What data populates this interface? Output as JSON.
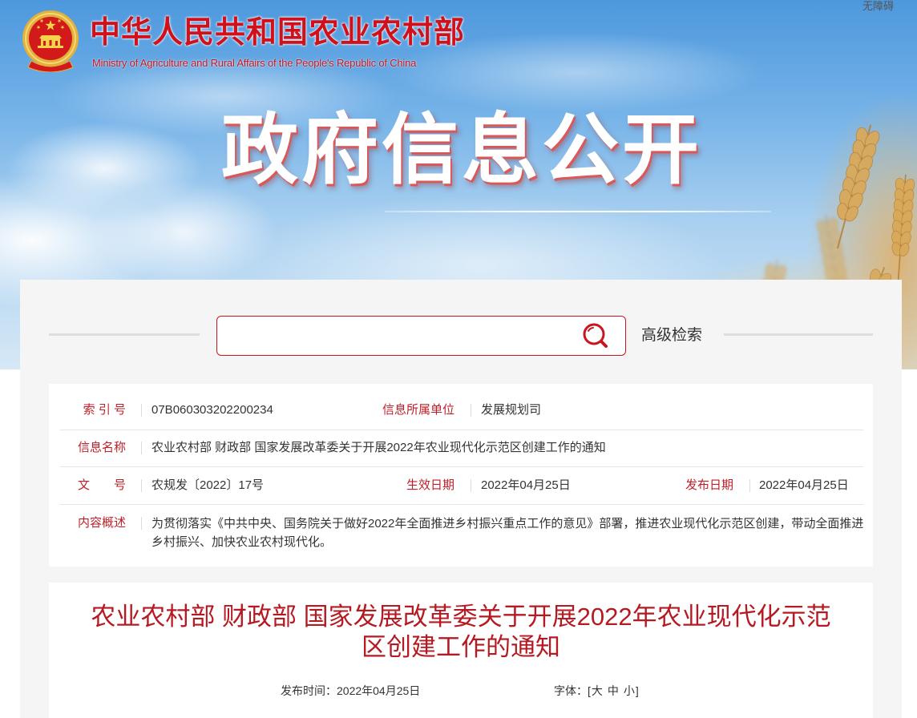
{
  "accessibility_link": "无障碍",
  "header": {
    "emblem_icon": "national-emblem-icon",
    "ministry_name_cn": "中华人民共和国农业农村部",
    "ministry_name_en": "Ministry of Agriculture and Rural Affairs of the People's Republic of China",
    "banner_title": "政府信息公开"
  },
  "search": {
    "search_icon": "search-icon",
    "advanced_search_label": "高级检索"
  },
  "info_table": {
    "index_no": {
      "label": "索 引 号",
      "value": "07B060303202200234"
    },
    "owner_unit": {
      "label": "信息所属单位",
      "value": "发展规划司"
    },
    "info_name": {
      "label": "信息名称",
      "value": "农业农村部 财政部 国家发展改革委关于开展2022年农业现代化示范区创建工作的通知"
    },
    "doc_no": {
      "label": "文　　号",
      "value": "农规发〔2022〕17号"
    },
    "effective_date": {
      "label": "生效日期",
      "value": "2022年04月25日"
    },
    "publish_date": {
      "label": "发布日期",
      "value": "2022年04月25日"
    },
    "summary": {
      "label": "内容概述",
      "value": "为贯彻落实《中共中央、国务院关于做好2022年全面推进乡村振兴重点工作的意见》部署，推进农业现代化示范区创建，带动全面推进乡村振兴、加快农业农村现代化。"
    }
  },
  "article": {
    "title": "农业农村部 财政部 国家发展改革委关于开展2022年农业现代化示范区创建工作的通知",
    "publish_time_label": "发布时间：",
    "publish_time_value": "2022年04月25日",
    "font_size_label": "字体：",
    "font_size_bracket_open": "[",
    "font_size_large": "大",
    "font_size_medium": "中",
    "font_size_small": "小",
    "font_size_bracket_close": "]"
  },
  "colors": {
    "brand_red": "#c8161e",
    "label_red": "#be1f28",
    "title_red": "#b51a22",
    "text_dark": "#333333",
    "sky_blue": "#4d98dd",
    "wheat_gold": "#dcae6a"
  }
}
